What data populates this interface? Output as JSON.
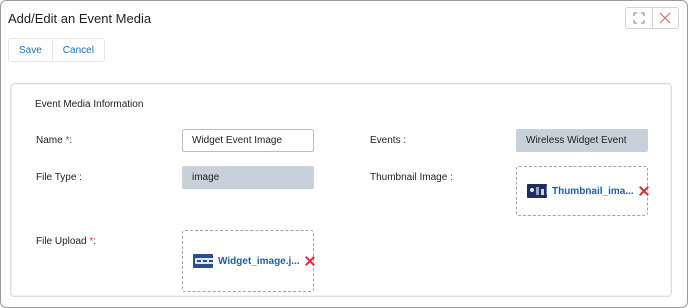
{
  "window": {
    "title": "Add/Edit an Event Media"
  },
  "toolbar": {
    "save_label": "Save",
    "cancel_label": "Cancel"
  },
  "section": {
    "title": "Event Media Information"
  },
  "fields": {
    "name": {
      "label": "Name ",
      "required_mark": "*",
      "suffix": ":",
      "value": "Widget Event Image"
    },
    "events": {
      "label": "Events :",
      "value": "Wireless Widget Event"
    },
    "file_type": {
      "label": "File Type :",
      "value": "image"
    },
    "thumbnail_image": {
      "label": "Thumbnail Image :",
      "file_name": "Thumbnail_ima..."
    },
    "file_upload": {
      "label": "File Upload  ",
      "required_mark": "*",
      "suffix": ":",
      "file_name": "Widget_image.j..."
    }
  },
  "icons": {
    "maximize": "maximize-icon",
    "close": "close-icon",
    "remove": "remove-icon"
  },
  "colors": {
    "accent": "#1f6fb2",
    "remove": "#d83333",
    "readonly_bg": "#c8d0da",
    "link": "#1f5fa5"
  }
}
